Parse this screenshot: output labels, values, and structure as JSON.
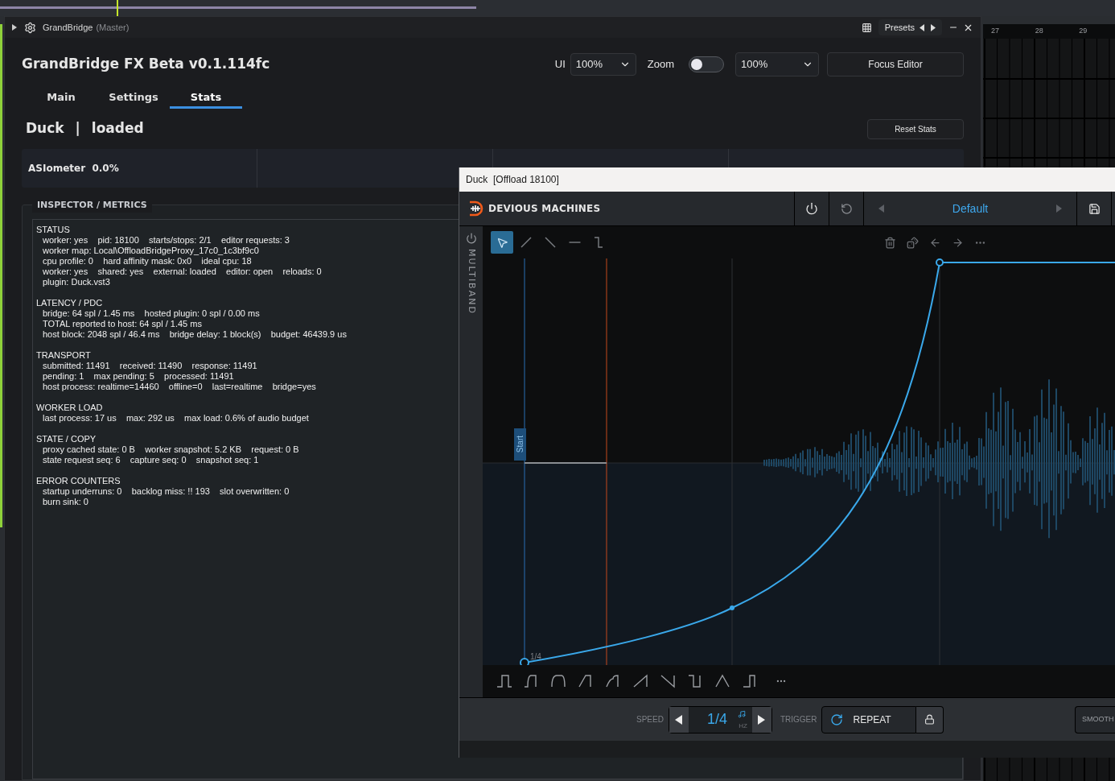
{
  "daw": {
    "ruler": [
      "27",
      "28",
      "29"
    ]
  },
  "host_window": {
    "title": "GrandBridge",
    "subtitle": "(Master)",
    "presets": "Presets"
  },
  "header": {
    "title": "GrandBridge FX Beta v0.1.114fc",
    "ui_label": "UI",
    "ui_scale": "100%",
    "zoom_label": "Zoom",
    "zoom_on": false,
    "zoom_value": "100%",
    "focus_button": "Focus Editor"
  },
  "tabs": [
    {
      "label": "Main",
      "selected": false
    },
    {
      "label": "Settings",
      "selected": false
    },
    {
      "label": "Stats",
      "selected": true
    }
  ],
  "status": {
    "plugin": "Duck",
    "separator": "|",
    "state": "loaded",
    "reset_button": "Reset Stats"
  },
  "meters": [
    "ASIometer  0.0%"
  ],
  "inspector": {
    "title": "INSPECTOR / METRICS",
    "sections": [
      {
        "heading": "STATUS",
        "lines": [
          "worker: yes    pid: 18100    starts/stops: 2/1    editor requests: 3",
          "worker map: Local\\OffloadBridgeProxy_17c0_1c3bf9c0",
          "cpu profile: 0    hard affinity mask: 0x0    ideal cpu: 18",
          "worker: yes    shared: yes    external: loaded    editor: open    reloads: 0",
          "plugin: Duck.vst3"
        ]
      },
      {
        "heading": "LATENCY / PDC",
        "lines": [
          "bridge: 64 spl / 1.45 ms    hosted plugin: 0 spl / 0.00 ms",
          "TOTAL reported to host: 64 spl / 1.45 ms",
          "host block: 2048 spl / 46.4 ms    bridge delay: 1 block(s)    budget: 46439.9 us"
        ]
      },
      {
        "heading": "TRANSPORT",
        "lines": [
          "submitted: 11491    received: 11490    response: 11491",
          "pending: 1    max pending: 5    processed: 11491",
          "host process: realtime=14460    offline=0    last=realtime    bridge=yes"
        ]
      },
      {
        "heading": "WORKER LOAD",
        "lines": [
          "last process: 17 us    max: 292 us    max load: 0.6% of audio budget"
        ]
      },
      {
        "heading": "STATE / COPY",
        "lines": [
          "proxy cached state: 0 B    worker snapshot: 5.2 KB    request: 0 B",
          "state request seq: 6    capture seq: 0    snapshot seq: 1"
        ]
      },
      {
        "heading": "ERROR COUNTERS",
        "lines": [
          "startup underruns: 0    backlog miss: !! 193    slot overwritten: 0",
          "burn sink: 0"
        ]
      }
    ]
  },
  "plugin_window": {
    "title": "Duck  [Offload 18100]",
    "brand": "DEVIOUS MACHINES",
    "preset": "Default",
    "sidebar_label": "MULTIBAND",
    "tools": [
      {
        "kind": "select",
        "selected": true
      },
      {
        "kind": "ramp-up",
        "selected": false
      },
      {
        "kind": "ramp-down",
        "selected": false
      },
      {
        "kind": "flat",
        "selected": false
      },
      {
        "kind": "step",
        "selected": false
      }
    ],
    "envelope": {
      "start_label": "Start",
      "point_label": "1/4"
    },
    "speed_label": "SPEED",
    "speed_value": "1/4",
    "speed_unit": "HZ",
    "trigger_label": "TRIGGER",
    "trigger_value": "REPEAT",
    "smooth_label": "SMOOTH"
  }
}
